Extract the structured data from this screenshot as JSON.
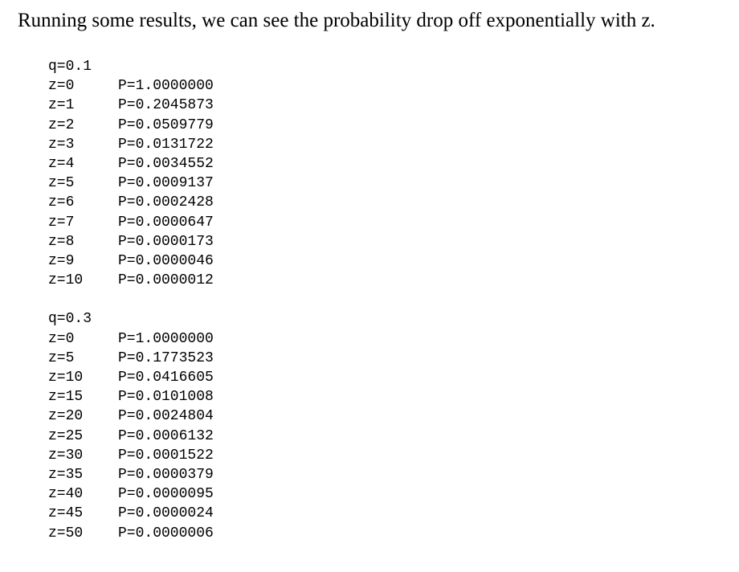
{
  "intro": {
    "text": "Running some results, we can see the probability drop off exponentially with z."
  },
  "results": {
    "blocks": [
      {
        "heading": "q=0.1",
        "rows": [
          {
            "z": "z=0",
            "p": "P=1.0000000"
          },
          {
            "z": "z=1",
            "p": "P=0.2045873"
          },
          {
            "z": "z=2",
            "p": "P=0.0509779"
          },
          {
            "z": "z=3",
            "p": "P=0.0131722"
          },
          {
            "z": "z=4",
            "p": "P=0.0034552"
          },
          {
            "z": "z=5",
            "p": "P=0.0009137"
          },
          {
            "z": "z=6",
            "p": "P=0.0002428"
          },
          {
            "z": "z=7",
            "p": "P=0.0000647"
          },
          {
            "z": "z=8",
            "p": "P=0.0000173"
          },
          {
            "z": "z=9",
            "p": "P=0.0000046"
          },
          {
            "z": "z=10",
            "p": "P=0.0000012"
          }
        ]
      },
      {
        "heading": "q=0.3",
        "rows": [
          {
            "z": "z=0",
            "p": "P=1.0000000"
          },
          {
            "z": "z=5",
            "p": "P=0.1773523"
          },
          {
            "z": "z=10",
            "p": "P=0.0416605"
          },
          {
            "z": "z=15",
            "p": "P=0.0101008"
          },
          {
            "z": "z=20",
            "p": "P=0.0024804"
          },
          {
            "z": "z=25",
            "p": "P=0.0006132"
          },
          {
            "z": "z=30",
            "p": "P=0.0001522"
          },
          {
            "z": "z=35",
            "p": "P=0.0000379"
          },
          {
            "z": "z=40",
            "p": "P=0.0000095"
          },
          {
            "z": "z=45",
            "p": "P=0.0000024"
          },
          {
            "z": "z=50",
            "p": "P=0.0000006"
          }
        ]
      }
    ]
  }
}
